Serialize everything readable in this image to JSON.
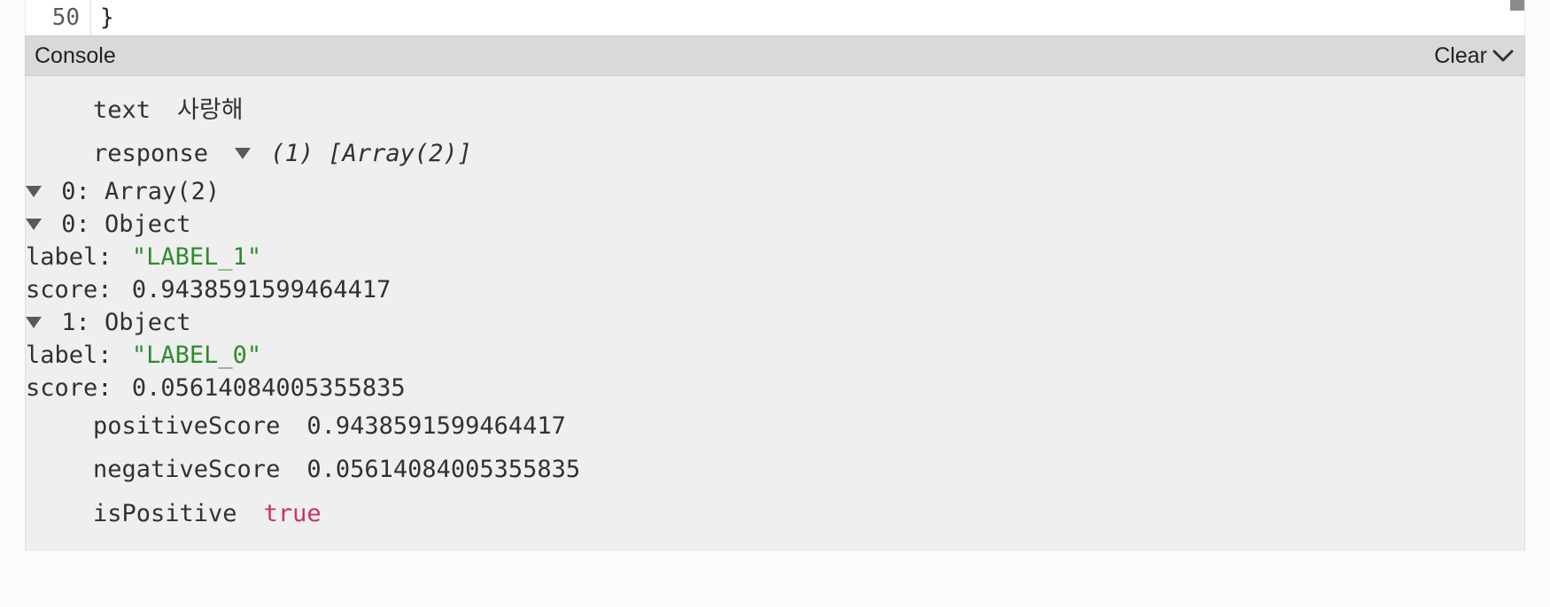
{
  "code": {
    "line_number": "50",
    "line_text": "}"
  },
  "header": {
    "title": "Console",
    "clear_label": "Clear"
  },
  "console": {
    "text_key": "text",
    "text_value": "사랑해",
    "response_key": "response",
    "response_summary": "(1) [Array(2)]",
    "arr0_label": "0: Array(2)",
    "obj0_label": "0: Object",
    "obj0_label_key": "label:",
    "obj0_label_val": "\"LABEL_1\"",
    "obj0_score_key": "score:",
    "obj0_score_val": "0.9438591599464417",
    "obj1_label": "1: Object",
    "obj1_label_key": "label:",
    "obj1_label_val": "\"LABEL_0\"",
    "obj1_score_key": "score:",
    "obj1_score_val": "0.05614084005355835",
    "positive_key": "positiveScore",
    "positive_val": "0.9438591599464417",
    "negative_key": "negativeScore",
    "negative_val": "0.05614084005355835",
    "ispositive_key": "isPositive",
    "ispositive_val": "true"
  }
}
